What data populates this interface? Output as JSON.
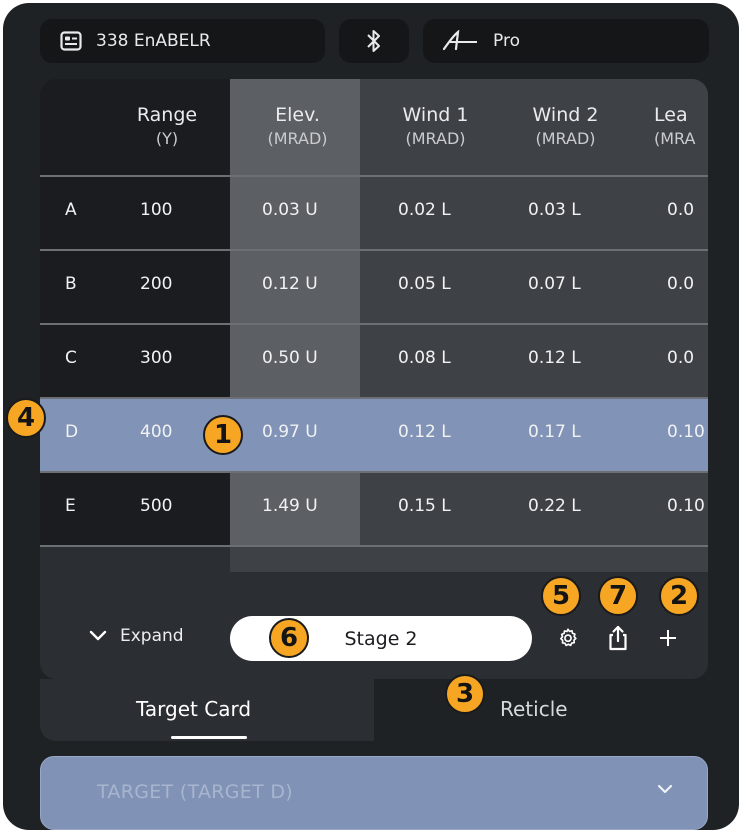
{
  "topbar": {
    "gun_profile": "338 EnABELR",
    "device_label": "Pro"
  },
  "table": {
    "headers": [
      {
        "title": "Range",
        "unit": "(Y)"
      },
      {
        "title": "Elev.",
        "unit": "(MRAD)"
      },
      {
        "title": "Wind 1",
        "unit": "(MRAD)"
      },
      {
        "title": "Wind 2",
        "unit": "(MRAD)"
      },
      {
        "title": "Lea",
        "unit": "(MRA"
      }
    ],
    "rows": [
      {
        "label": "A",
        "range": "100",
        "elev": "0.03 U",
        "wind1": "0.02 L",
        "wind2": "0.03 L",
        "lead": "0.0 "
      },
      {
        "label": "B",
        "range": "200",
        "elev": "0.12 U",
        "wind1": "0.05 L",
        "wind2": "0.07 L",
        "lead": "0.0 "
      },
      {
        "label": "C",
        "range": "300",
        "elev": "0.50 U",
        "wind1": "0.08 L",
        "wind2": "0.12 L",
        "lead": "0.0 "
      },
      {
        "label": "D",
        "range": "400",
        "elev": "0.97 U",
        "wind1": "0.12 L",
        "wind2": "0.17 L",
        "lead": "0.10"
      },
      {
        "label": "E",
        "range": "500",
        "elev": "1.49 U",
        "wind1": "0.15 L",
        "wind2": "0.22 L",
        "lead": "0.10"
      }
    ]
  },
  "controls": {
    "expand_label": "Expand",
    "stage_label": "Stage 2"
  },
  "tabs": {
    "target_card": "Target Card",
    "reticle": "Reticle"
  },
  "dropdown": {
    "value": "TARGET (TARGET D)"
  },
  "callouts": [
    "1",
    "2",
    "3",
    "4",
    "5",
    "6",
    "7"
  ],
  "colors": {
    "background": "#1f2225",
    "selected_row": "#8193b6",
    "accent_badge": "#f6a623",
    "dropdown": "#8092b5"
  }
}
